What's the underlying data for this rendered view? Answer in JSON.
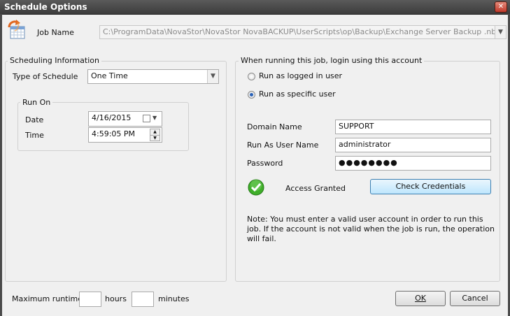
{
  "window": {
    "title": "Schedule Options",
    "close_glyph": "✕"
  },
  "job": {
    "label": "Job Name",
    "path": "C:\\ProgramData\\NovaStor\\NovaStor NovaBACKUP\\UserScripts\\op\\Backup\\Exchange Server Backup .nbk",
    "icon": "calendar-refresh-icon"
  },
  "scheduling": {
    "group_title": "Scheduling Information",
    "type_label": "Type of Schedule",
    "type_value": "One Time",
    "run_on_title": "Run On",
    "date_label": "Date",
    "date_value": "4/16/2015",
    "time_label": "Time",
    "time_value": "4:59:05 PM"
  },
  "login": {
    "group_title": "When running this job, login using this account",
    "radio_logged_in": "Run as logged in user",
    "radio_specific": "Run as specific user",
    "selected": "specific",
    "domain_label": "Domain Name",
    "domain_value": "SUPPORT",
    "user_label": "Run As User Name",
    "user_value": "administrator",
    "password_label": "Password",
    "password_value": "●●●●●●●●",
    "status_text": "Access Granted",
    "status_color": "#3fae2a",
    "check_button": "Check Credentials",
    "note": "Note: You must enter a valid user account in order to run this job. If the account is not valid when the job is run, the operation will fail."
  },
  "footer": {
    "max_runtime_label": "Maximum runtime:",
    "hours_value": "",
    "hours_label": "hours",
    "minutes_value": "",
    "minutes_label": "minutes",
    "ok_button": "OK",
    "cancel_button": "Cancel"
  }
}
